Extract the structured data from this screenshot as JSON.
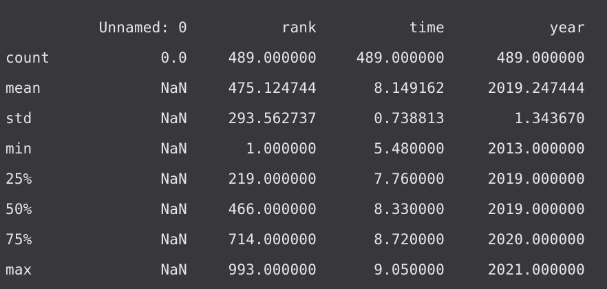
{
  "table": {
    "headers": [
      "",
      "Unnamed: 0",
      "rank",
      "time",
      "year"
    ],
    "rows": [
      {
        "label": "count",
        "values": [
          "0.0",
          "489.000000",
          "489.000000",
          "489.000000"
        ]
      },
      {
        "label": "mean",
        "values": [
          "NaN",
          "475.124744",
          "8.149162",
          "2019.247444"
        ]
      },
      {
        "label": "std",
        "values": [
          "NaN",
          "293.562737",
          "0.738813",
          "1.343670"
        ]
      },
      {
        "label": "min",
        "values": [
          "NaN",
          "1.000000",
          "5.480000",
          "2013.000000"
        ]
      },
      {
        "label": "25%",
        "values": [
          "NaN",
          "219.000000",
          "7.760000",
          "2019.000000"
        ]
      },
      {
        "label": "50%",
        "values": [
          "NaN",
          "466.000000",
          "8.330000",
          "2019.000000"
        ]
      },
      {
        "label": "75%",
        "values": [
          "NaN",
          "714.000000",
          "8.720000",
          "2020.000000"
        ]
      },
      {
        "label": "max",
        "values": [
          "NaN",
          "993.000000",
          "9.050000",
          "2021.000000"
        ]
      }
    ]
  },
  "colors": {
    "background": "#38373c",
    "text": "#e7e7ea"
  }
}
